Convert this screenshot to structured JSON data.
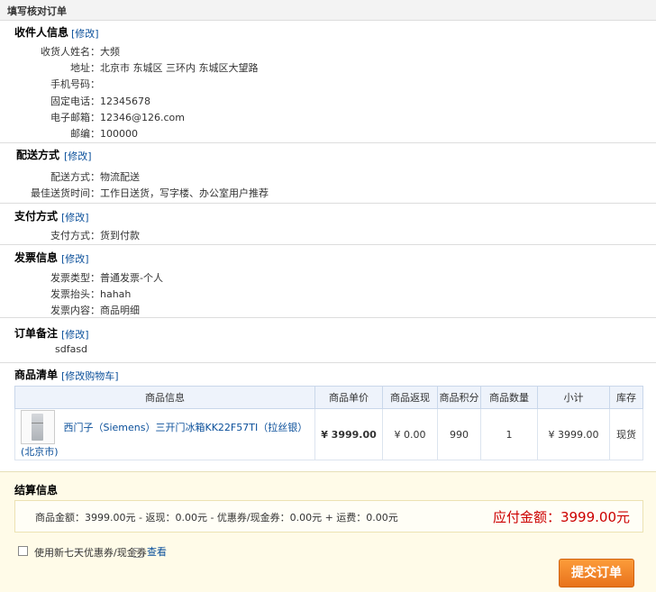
{
  "header": {
    "title": "填写核对订单"
  },
  "receiver": {
    "title": "收件人信息",
    "modify": "[修改]",
    "fields": [
      {
        "label": "收货人姓名：",
        "value": "大频"
      },
      {
        "label": "地址：",
        "value": "北京市 东城区 三环内 东城区大望路"
      },
      {
        "label": "手机号码：",
        "value": ""
      },
      {
        "label": "固定电话：",
        "value": "12345678"
      },
      {
        "label": "电子邮箱：",
        "value": "12346@126.com"
      },
      {
        "label": "邮编：",
        "value": "100000"
      }
    ]
  },
  "delivery": {
    "title": "配送方式",
    "modify": "[修改]",
    "fields": [
      {
        "label": "配送方式：",
        "value": "物流配送"
      },
      {
        "label": "最佳送货时间：",
        "value": "工作日送货，写字楼、办公室用户推荐"
      }
    ]
  },
  "payment": {
    "title": "支付方式",
    "modify": "[修改]",
    "fields": [
      {
        "label": "支付方式：",
        "value": "货到付款"
      }
    ]
  },
  "invoice": {
    "title": "发票信息",
    "modify": "[修改]",
    "fields": [
      {
        "label": "发票类型：",
        "value": "普通发票-个人"
      },
      {
        "label": "发票抬头：",
        "value": "hahah"
      },
      {
        "label": "发票内容：",
        "value": "商品明细"
      }
    ]
  },
  "remark": {
    "title": "订单备注",
    "modify": "[修改]",
    "text": "sdfasd"
  },
  "items": {
    "title": "商品清单",
    "modify": "[修改购物车]",
    "columns": [
      "商品信息",
      "商品单价",
      "商品返现",
      "商品积分",
      "商品数量",
      "小计",
      "库存"
    ],
    "rows": [
      {
        "name": "西门子（Siemens）三开门冰箱KK22F57TI（拉丝银）(北京市)",
        "price": "¥ 3999.00",
        "cashback": "¥ 0.00",
        "points": "990",
        "qty": "1",
        "subtotal": "¥ 3999.00",
        "stock": "现货"
      }
    ]
  },
  "settlement": {
    "title": "结算信息",
    "summary": "商品金额：3999.00元 - 返现：0.00元 - 优惠券/现金券：0.00元 + 运费：0.00元",
    "due": "应付金额：3999.00元",
    "coupon_label": "使用新七天优惠券/现金券",
    "view_label": "查看",
    "submit": "提交订单"
  }
}
